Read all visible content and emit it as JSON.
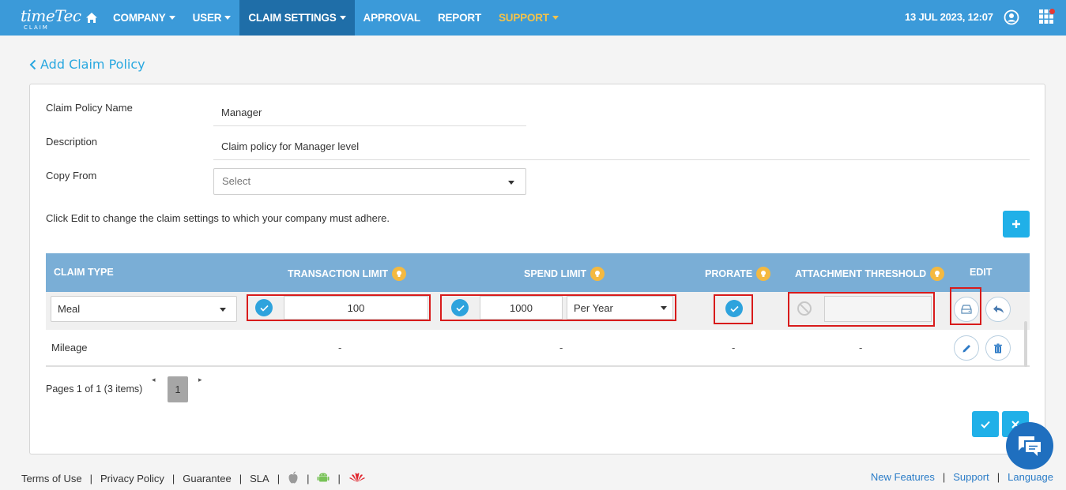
{
  "nav": {
    "logo_main": "timeTec",
    "logo_sub": "CLAIM",
    "items": [
      {
        "label": "COMPANY",
        "dropdown": true
      },
      {
        "label": "USER",
        "dropdown": true
      },
      {
        "label": "CLAIM SETTINGS",
        "dropdown": true,
        "active": true
      },
      {
        "label": "APPROVAL",
        "dropdown": false
      },
      {
        "label": "REPORT",
        "dropdown": false
      },
      {
        "label": "SUPPORT",
        "dropdown": true
      }
    ],
    "datetime": "13 JUL 2023, 12:07",
    "accent": "#3b9ad9",
    "active_bg": "#1f6ea8",
    "support_color": "#f1c24c"
  },
  "page": {
    "title": "Add Claim Policy"
  },
  "form": {
    "name_label": "Claim Policy Name",
    "name_value": "Manager",
    "desc_label": "Description",
    "desc_value": "Claim policy for Manager level",
    "copy_label": "Copy From",
    "copy_placeholder": "Select",
    "hint": "Click Edit to change the claim settings to which your company must adhere."
  },
  "table": {
    "headers": {
      "claim_type": "CLAIM TYPE",
      "transaction_limit": "TRANSACTION LIMIT",
      "spend_limit": "SPEND LIMIT",
      "prorate": "PRORATE",
      "attachment_threshold": "ATTACHMENT THRESHOLD",
      "edit": "EDIT"
    },
    "editing_row": {
      "claim_type": "Meal",
      "transaction_limit": "100",
      "spend_limit": "1000",
      "spend_period": "Per Year",
      "prorate_checked": true,
      "attachment_threshold": ""
    },
    "rows": [
      {
        "claim_type": "Mileage",
        "transaction_limit": "-",
        "spend_limit": "-",
        "prorate": "-",
        "attachment_threshold": "-"
      }
    ]
  },
  "pager": {
    "summary": "Pages 1 of 1 (3 items)",
    "current_page": "1"
  },
  "footer": {
    "left_links": [
      "Terms of Use",
      "Privacy Policy",
      "Guarantee",
      "SLA"
    ],
    "right_links": [
      "New Features",
      "Support",
      "Language"
    ]
  }
}
